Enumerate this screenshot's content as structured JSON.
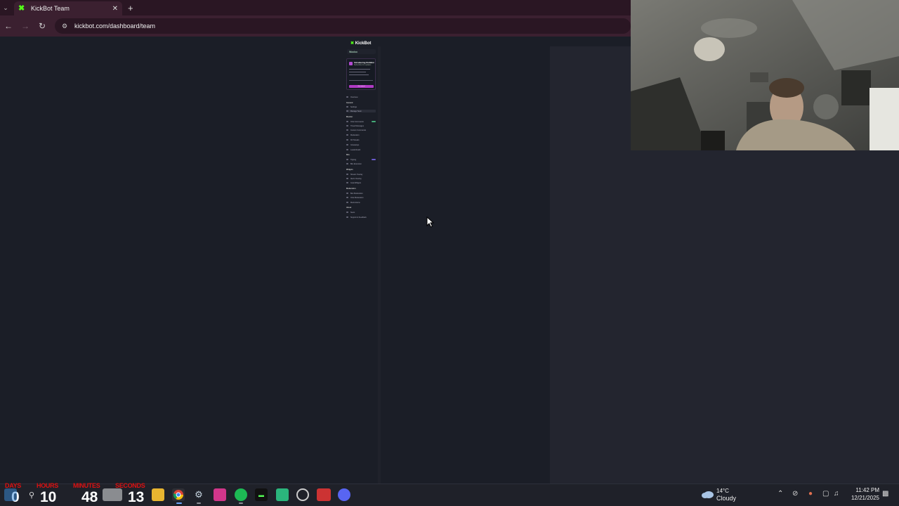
{
  "browser": {
    "tab_title": "KickBot Team",
    "url": "kickbot.com/dashboard/team"
  },
  "dashboard": {
    "logo_text": "KickBot",
    "workspace_label": "Wooloo",
    "promo": {
      "title": "Introducing KickBot",
      "subtitle": "Subscribe for updates",
      "cta": "Get started"
    },
    "nav_sections": [
      "General",
      "Monitor",
      "Bits",
      "Widgets",
      "Moderation",
      "About"
    ],
    "nav_items": [
      "Overview",
      "Settings",
      "Manage Team",
      "Chat Commands",
      "Timed Messages",
      "Custom Commands",
      "Moderation",
      "Kill Streaks",
      "Giveaways",
      "Leaderboard",
      "Tipping",
      "Bits Extension",
      "Stream Overlay",
      "Alerts Overlay",
      "Goal Widgets",
      "Ban Moderation",
      "Chat Moderation",
      "Mod Actions",
      "News",
      "Support & Feedback"
    ]
  },
  "countdown": {
    "labels": {
      "days": "DAYS",
      "hours": "HOURS",
      "minutes": "MINUTES",
      "seconds": "SECONDS"
    },
    "values": {
      "days": "0",
      "hours": "10",
      "minutes": "48",
      "seconds": "13"
    }
  },
  "taskbar": {
    "apps": [
      "windows-start",
      "search",
      "file-explorer",
      "chrome",
      "steam",
      "instagram",
      "spotify",
      "terminal",
      "app-green",
      "obs",
      "video-app",
      "discord"
    ]
  },
  "weather": {
    "temp": "14°C",
    "condition": "Cloudy"
  },
  "clock": {
    "time": "11:42 PM",
    "date": "12/21/2025"
  },
  "colors": {
    "accent_green": "#53fc18",
    "tab_bar": "#2a1623",
    "page_bg": "#1b1e27",
    "promo_purple": "#b03ac4",
    "countdown_red": "#dd1111"
  }
}
